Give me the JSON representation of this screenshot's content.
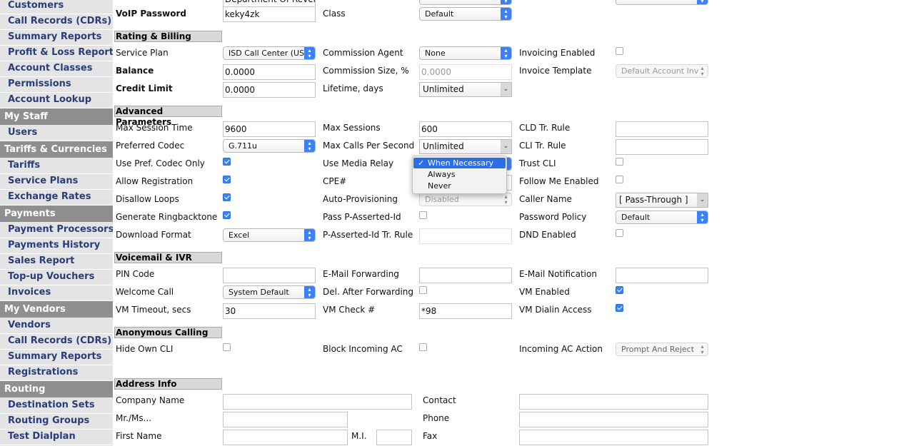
{
  "sidebar": {
    "items": [
      {
        "label": "Customers",
        "section": false
      },
      {
        "label": "Call Records (CDRs)",
        "section": false
      },
      {
        "label": "Summary Reports",
        "section": false
      },
      {
        "label": "Profit & Loss Report",
        "section": false
      },
      {
        "label": "Account Classes",
        "section": false
      },
      {
        "label": "Permissions",
        "section": false
      },
      {
        "label": "Account Lookup",
        "section": false
      },
      {
        "label": "My Staff",
        "section": true
      },
      {
        "label": "Users",
        "section": false
      },
      {
        "label": "Tariffs & Currencies",
        "section": true
      },
      {
        "label": "Tariffs",
        "section": false
      },
      {
        "label": "Service Plans",
        "section": false
      },
      {
        "label": "Exchange Rates",
        "section": false
      },
      {
        "label": "Payments",
        "section": true
      },
      {
        "label": "Payment Processors",
        "section": false
      },
      {
        "label": "Payments History",
        "section": false
      },
      {
        "label": "Sales Report",
        "section": false
      },
      {
        "label": "Top-up Vouchers",
        "section": false
      },
      {
        "label": "Invoices",
        "section": false
      },
      {
        "label": "My Vendors",
        "section": true
      },
      {
        "label": "Vendors",
        "section": false
      },
      {
        "label": "Call Records (CDRs)",
        "section": false
      },
      {
        "label": "Summary Reports",
        "section": false
      },
      {
        "label": "Registrations",
        "section": false
      },
      {
        "label": "Routing",
        "section": true
      },
      {
        "label": "Destination Sets",
        "section": false
      },
      {
        "label": "Routing Groups",
        "section": false
      },
      {
        "label": "Test Dialplan",
        "section": false
      }
    ]
  },
  "top": {
    "partial_value": "Department Of Revenu",
    "voip_password_label": "VoIP Password",
    "voip_password_value": "keky4zk",
    "class_label": "Class",
    "class_value": "Default"
  },
  "rating": {
    "header": "Rating & Billing",
    "service_plan_label": "Service Plan",
    "service_plan_value": "ISD Call Center (US",
    "commission_agent_label": "Commission Agent",
    "commission_agent_value": "None",
    "invoicing_enabled_label": "Invoicing Enabled",
    "balance_label": "Balance",
    "balance_value": "0.0000",
    "commission_size_label": "Commission Size, %",
    "commission_size_value": "0.0000",
    "invoice_template_label": "Invoice Template",
    "invoice_template_value": "Default Account Inv",
    "credit_limit_label": "Credit Limit",
    "credit_limit_value": "0.0000",
    "lifetime_label": "Lifetime, days",
    "lifetime_value": "Unlimited"
  },
  "advanced": {
    "header": "Advanced Parameters",
    "max_session_time_label": "Max Session Time",
    "max_session_time_value": "9600",
    "max_sessions_label": "Max Sessions",
    "max_sessions_value": "600",
    "cld_rule_label": "CLD Tr. Rule",
    "preferred_codec_label": "Preferred Codec",
    "preferred_codec_value": "G.711u",
    "max_cps_label": "Max Calls Per Second",
    "max_cps_value": "Unlimited",
    "cli_rule_label": "CLI Tr. Rule",
    "use_pref_codec_label": "Use Pref. Codec Only",
    "use_media_relay_label": "Use Media Relay",
    "trust_cli_label": "Trust CLI",
    "allow_registration_label": "Allow Registration",
    "cpe_label": "CPE#",
    "follow_me_label": "Follow Me Enabled",
    "disallow_loops_label": "Disallow Loops",
    "auto_prov_label": "Auto-Provisioning",
    "auto_prov_value": "Disabled",
    "caller_name_label": "Caller Name",
    "caller_name_value": "[ Pass-Through ]",
    "gen_ringback_label": "Generate Ringbacktone",
    "pass_pai_label": "Pass P-Asserted-Id",
    "password_policy_label": "Password Policy",
    "password_policy_value": "Default",
    "download_format_label": "Download Format",
    "download_format_value": "Excel",
    "pai_rule_label": "P-Asserted-Id Tr. Rule",
    "dnd_label": "DND Enabled"
  },
  "media_relay_dropdown": {
    "options": [
      "When Necessary",
      "Always",
      "Never"
    ],
    "selected": "When Necessary",
    "check": "✓"
  },
  "voicemail": {
    "header": "Voicemail & IVR",
    "pin_label": "PIN Code",
    "email_fwd_label": "E-Mail Forwarding",
    "email_notif_label": "E-Mail Notification",
    "welcome_call_label": "Welcome Call",
    "welcome_call_value": "System Default",
    "del_after_fwd_label": "Del. After Forwarding",
    "vm_enabled_label": "VM Enabled",
    "vm_timeout_label": "VM Timeout, secs",
    "vm_timeout_value": "30",
    "vm_check_label": "VM Check #",
    "vm_check_value": "*98",
    "vm_dialin_label": "VM Dialin Access"
  },
  "anonymous": {
    "header": "Anonymous Calling",
    "hide_cli_label": "Hide Own CLI",
    "block_ac_label": "Block Incoming AC",
    "incoming_ac_label": "Incoming AC Action",
    "incoming_ac_value": "Prompt And Reject"
  },
  "address": {
    "header": "Address Info",
    "company_label": "Company Name",
    "contact_label": "Contact",
    "mr_label": "Mr./Ms...",
    "phone_label": "Phone",
    "first_name_label": "First Name",
    "mi_label": "M.I.",
    "fax_label": "Fax"
  },
  "icons": {
    "select_arrows": "⌃⌄",
    "select_down": "▾",
    "updown": "⬍"
  },
  "colors": {
    "link": "#2b3d78",
    "section_bg": "#8f8f8f",
    "accent": "#3b82f6"
  }
}
